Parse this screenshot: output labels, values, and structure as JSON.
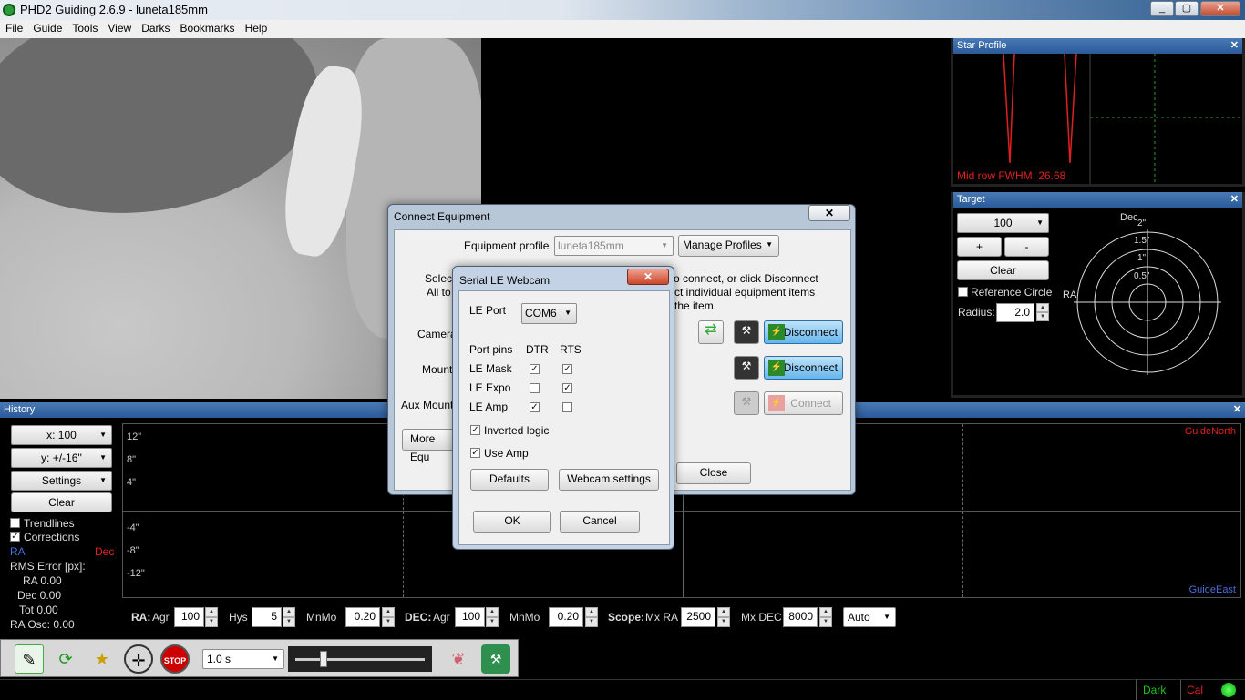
{
  "window": {
    "title": "PHD2 Guiding 2.6.9 - luneta185mm",
    "min": "_",
    "max": "▢",
    "close": "✕"
  },
  "menu": [
    "File",
    "Guide",
    "Tools",
    "View",
    "Darks",
    "Bookmarks",
    "Help"
  ],
  "star_profile": {
    "title": "Star Profile",
    "fwhm": "Mid row FWHM: 26.68"
  },
  "target": {
    "title": "Target",
    "zoom": "100",
    "plus": "+",
    "minus": "-",
    "clear": "Clear",
    "reference_circle": "Reference Circle",
    "radius_label": "Radius:",
    "radius_value": "2.0",
    "dec_label": "Dec",
    "ra_label": "RA",
    "rings": [
      "2\"",
      "1.5\"",
      "1\"",
      "0.5\""
    ]
  },
  "history": {
    "title": "History",
    "x_scale": "x: 100",
    "y_scale": "y: +/-16''",
    "settings": "Settings",
    "clear": "Clear",
    "trendlines": "Trendlines",
    "corrections": "Corrections",
    "ra": "RA",
    "dec": "Dec",
    "rms_label": "RMS Error [px]:",
    "rms_ra": "RA 0.00",
    "rms_dec": "Dec 0.00",
    "rms_tot": "Tot 0.00",
    "ra_osc": "RA Osc: 0.00",
    "y_labels": [
      "12\"",
      "8\"",
      "4\"",
      "-4\"",
      "-8\"",
      "-12\""
    ],
    "guide_north": "GuideNorth",
    "guide_east": "GuideEast"
  },
  "params": {
    "ra_label": "RA:",
    "agr": "Agr",
    "ra_agr": "100",
    "hys": "Hys",
    "ra_hys": "5",
    "mnmo": "MnMo",
    "ra_mnmo": "0.20",
    "dec_label": "DEC:",
    "dec_agr": "100",
    "dec_mnmo": "0.20",
    "scope_label": "Scope:",
    "mxra": "Mx RA",
    "mxra_value": "2500",
    "mxdec": "Mx DEC",
    "mxdec_value": "8000",
    "mode": "Auto"
  },
  "toolbar": {
    "exposure": "1.0 s",
    "stop": "STOP"
  },
  "status": {
    "dark": "Dark",
    "cal": "Cal"
  },
  "connect": {
    "title": "Connect Equipment",
    "close_x": "✕",
    "profile_label": "Equipment profile",
    "profile_value": "luneta185mm",
    "manage": "Manage Profiles",
    "info_left_1": "Select",
    "info_left_2": "All to",
    "info_right_1": "o connect, or click Disconnect",
    "info_right_2": "ct individual equipment items",
    "info_right_3": "the item.",
    "camera": "Camera",
    "mount": "Mount",
    "aux_mount": "Aux Mount",
    "disconnect": "Disconnect",
    "connect": "Connect",
    "more": "More Equ",
    "close": "Close"
  },
  "serial": {
    "title": "Serial LE Webcam",
    "port_label": "LE Port",
    "port_value": "COM6",
    "port_pins": "Port pins",
    "dtr": "DTR",
    "rts": "RTS",
    "rows": [
      {
        "label": "LE Mask",
        "dtr": true,
        "rts": true
      },
      {
        "label": "LE Expo",
        "dtr": false,
        "rts": true
      },
      {
        "label": "LE Amp",
        "dtr": true,
        "rts": false
      }
    ],
    "inverted": "Inverted logic",
    "use_amp": "Use Amp",
    "defaults": "Defaults",
    "webcam_settings": "Webcam settings",
    "ok": "OK",
    "cancel": "Cancel"
  },
  "colors": {
    "guide_north": "#e02020",
    "guide_east": "#4a6ee0",
    "ra": "#4a6ee0",
    "dec": "#e02020",
    "status_green": "#18c818"
  }
}
